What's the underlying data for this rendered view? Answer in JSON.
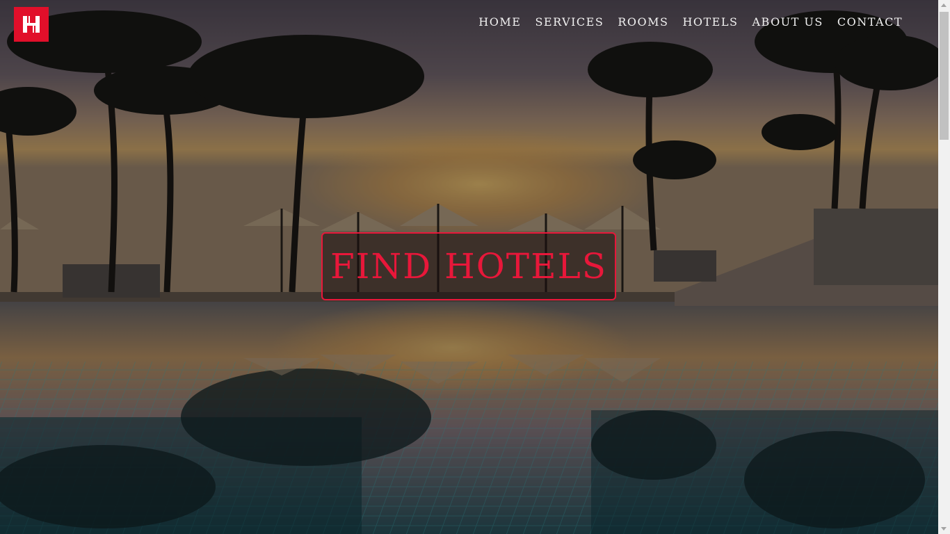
{
  "brand": {
    "logo_letter": "H",
    "accent_color": "#e10f2a"
  },
  "nav": {
    "items": [
      {
        "label": "HOME"
      },
      {
        "label": "SERVICES"
      },
      {
        "label": "ROOMS"
      },
      {
        "label": "HOTELS"
      },
      {
        "label": "ABOUT US"
      },
      {
        "label": "CONTACT"
      }
    ]
  },
  "hero": {
    "background": "resort-pool-sunset-palms-image",
    "cta_label": "FIND HOTELS",
    "cta_color": "#e8173a"
  },
  "scrollbar": {
    "position_fraction": 0
  }
}
